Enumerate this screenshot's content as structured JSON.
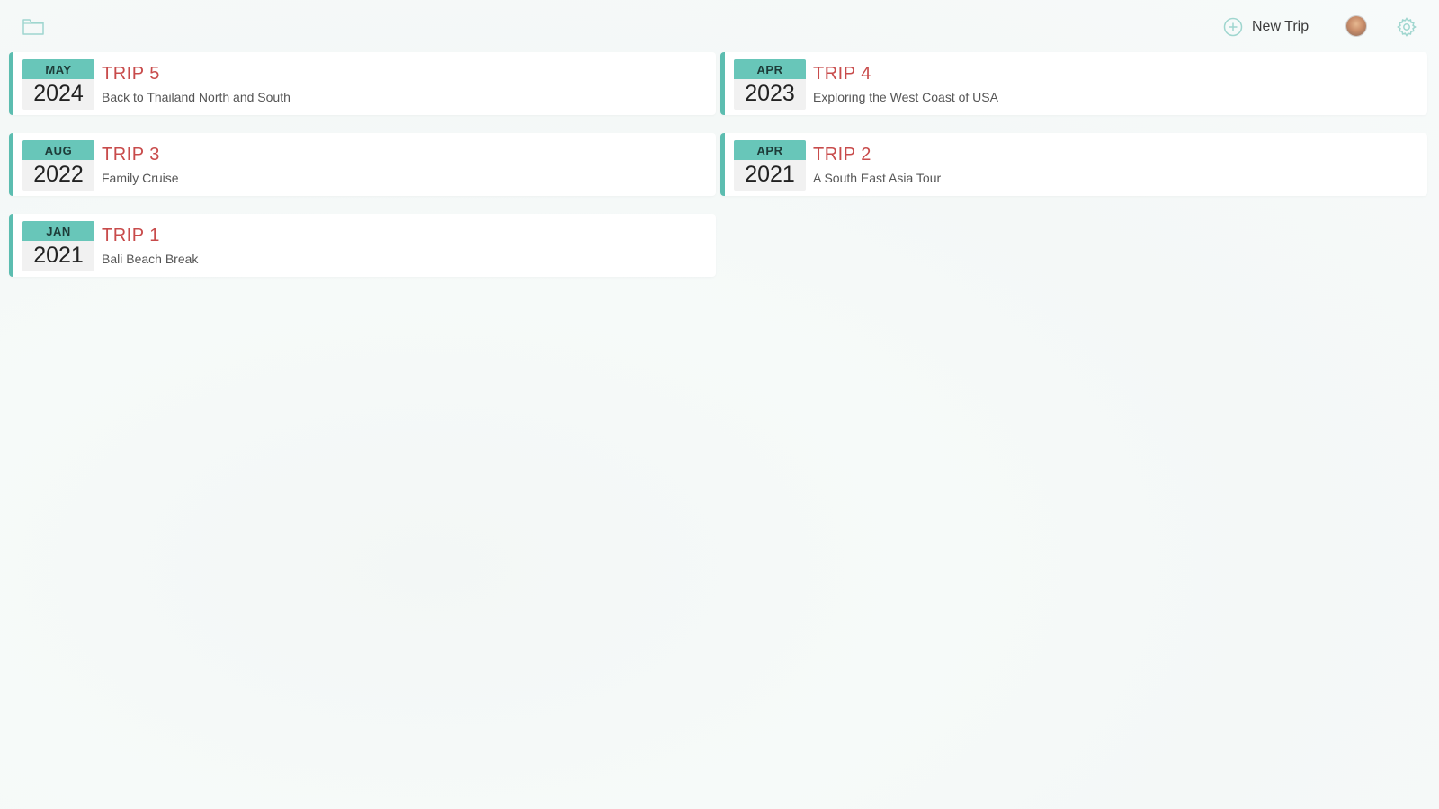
{
  "header": {
    "folder_icon": "folder-icon",
    "new_trip_icon": "plus-circle-icon",
    "new_trip_label": "New Trip",
    "avatar_icon": "user-avatar",
    "settings_icon": "gear-icon"
  },
  "colors": {
    "accent": "#5cbdb0",
    "month_band": "#68c6b9",
    "title_red": "#c84b4b"
  },
  "trips": [
    {
      "month": "MAY",
      "year": "2024",
      "title": "TRIP 5",
      "subtitle": "Back to Thailand North and South"
    },
    {
      "month": "APR",
      "year": "2023",
      "title": "TRIP 4",
      "subtitle": "Exploring the West Coast of USA"
    },
    {
      "month": "AUG",
      "year": "2022",
      "title": "TRIP 3",
      "subtitle": "Family Cruise"
    },
    {
      "month": "APR",
      "year": "2021",
      "title": "TRIP 2",
      "subtitle": "A South East Asia Tour"
    },
    {
      "month": "JAN",
      "year": "2021",
      "title": "TRIP 1",
      "subtitle": "Bali Beach Break"
    }
  ]
}
